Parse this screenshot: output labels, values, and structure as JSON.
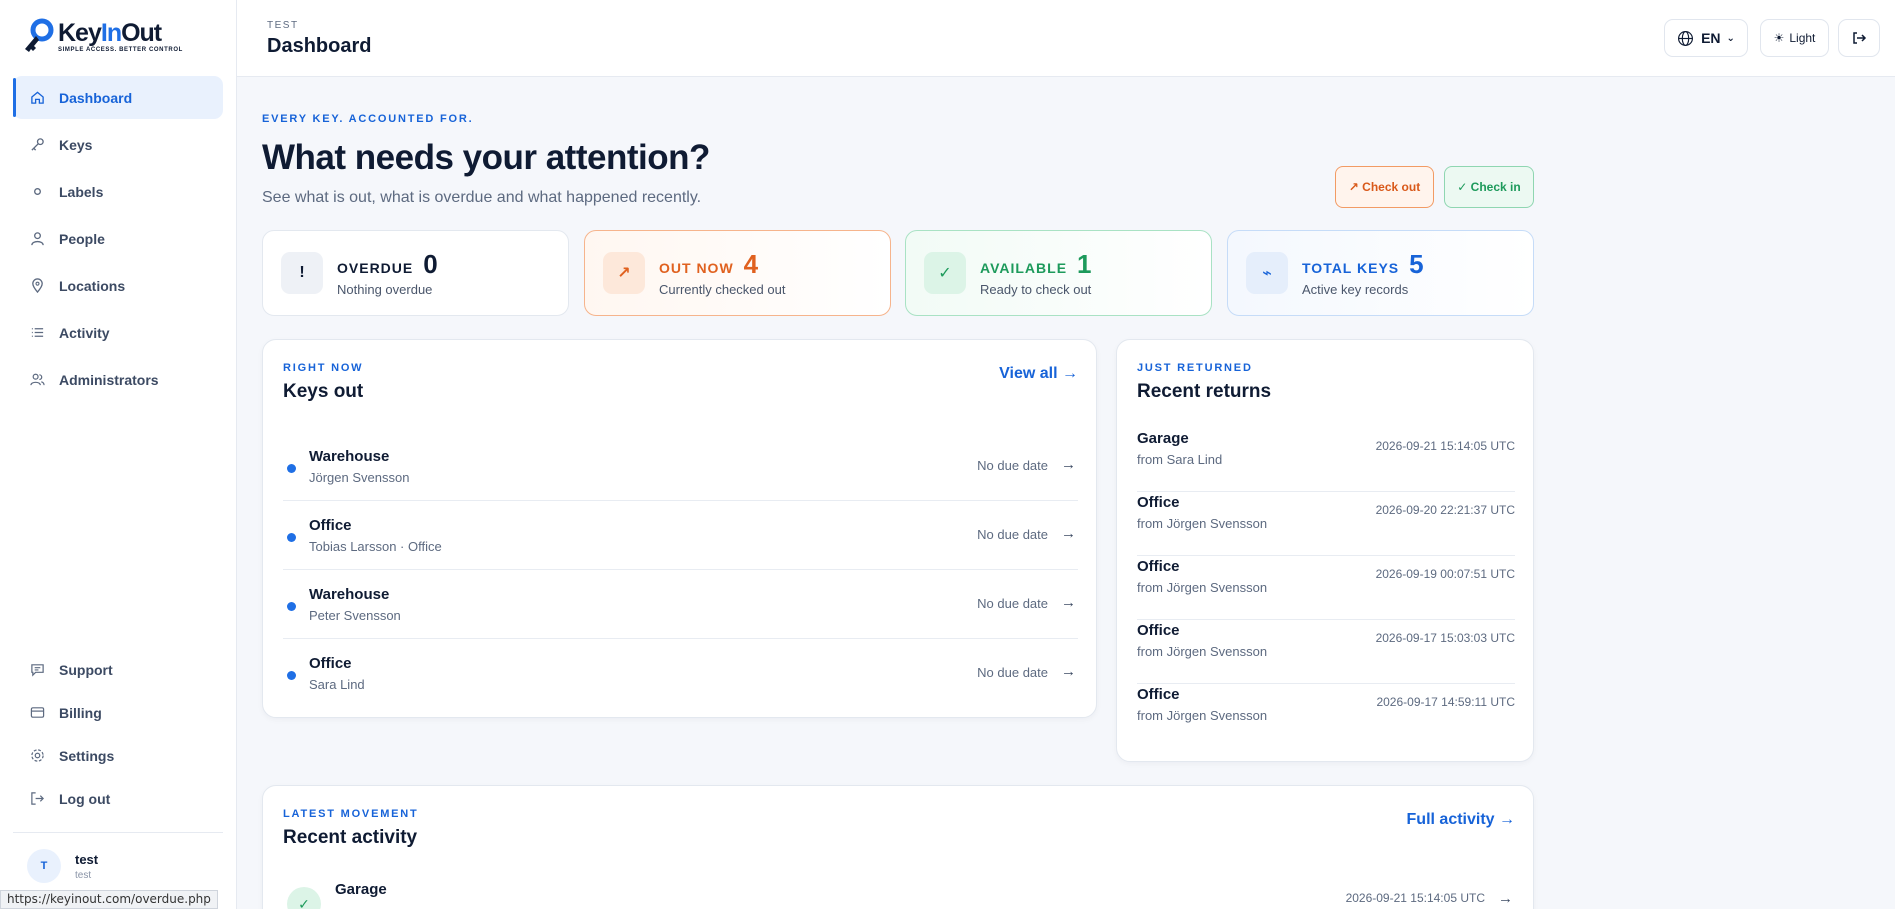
{
  "app": {
    "name_part1": "Key",
    "name_part2": "In",
    "name_part3": "Out",
    "tagline": "SIMPLE ACCESS. BETTER CONTROL",
    "accent_color": "#1f6fe5"
  },
  "sidebar": {
    "items": [
      {
        "label": "Dashboard",
        "icon": "home-icon",
        "active": true
      },
      {
        "label": "Keys",
        "icon": "key-icon"
      },
      {
        "label": "Labels",
        "icon": "circle-icon"
      },
      {
        "label": "People",
        "icon": "user-icon"
      },
      {
        "label": "Locations",
        "icon": "pin-icon"
      },
      {
        "label": "Activity",
        "icon": "list-icon"
      },
      {
        "label": "Administrators",
        "icon": "users-icon"
      }
    ],
    "bottom_items": [
      {
        "label": "Support",
        "icon": "chat-icon"
      },
      {
        "label": "Billing",
        "icon": "card-icon"
      },
      {
        "label": "Settings",
        "icon": "gear-icon"
      },
      {
        "label": "Log out",
        "icon": "logout-icon"
      }
    ],
    "user": {
      "initial": "T",
      "name": "test",
      "sub": "test"
    }
  },
  "status_url": "https://keyinout.com/overdue.php",
  "topbar": {
    "crumb": "TEST",
    "title": "Dashboard",
    "lang": "EN",
    "theme": "Light"
  },
  "hero": {
    "kicker": "EVERY KEY. ACCOUNTED FOR.",
    "title": "What needs your attention?",
    "subtitle": "See what is out, what is overdue and what happened recently.",
    "checkout_label": "↗ Check out",
    "checkin_label": "✓ Check in"
  },
  "stats": [
    {
      "label": "OVERDUE",
      "value": "0",
      "desc": "Nothing overdue",
      "glyph": "!"
    },
    {
      "label": "OUT NOW",
      "value": "4",
      "desc": "Currently checked out",
      "glyph": "↗"
    },
    {
      "label": "AVAILABLE",
      "value": "1",
      "desc": "Ready to check out",
      "glyph": "✓"
    },
    {
      "label": "TOTAL KEYS",
      "value": "5",
      "desc": "Active key records",
      "glyph": "⌁"
    }
  ],
  "keys_out": {
    "kicker": "RIGHT NOW",
    "title": "Keys out",
    "link": "View all →",
    "rows": [
      {
        "name": "Warehouse",
        "who": "Jörgen Svensson",
        "due": "No due date"
      },
      {
        "name": "Office",
        "who": "Tobias Larsson · Office",
        "due": "No due date"
      },
      {
        "name": "Warehouse",
        "who": "Peter Svensson",
        "due": "No due date"
      },
      {
        "name": "Office",
        "who": "Sara Lind",
        "due": "No due date"
      }
    ]
  },
  "returns": {
    "kicker": "JUST RETURNED",
    "title": "Recent returns",
    "rows": [
      {
        "name": "Garage",
        "from": "from Sara Lind",
        "time": "2026-09-21 15:14:05 UTC"
      },
      {
        "name": "Office",
        "from": "from Jörgen Svensson",
        "time": "2026-09-20 22:21:37 UTC"
      },
      {
        "name": "Office",
        "from": "from Jörgen Svensson",
        "time": "2026-09-19 00:07:51 UTC"
      },
      {
        "name": "Office",
        "from": "from Jörgen Svensson",
        "time": "2026-09-17 15:03:03 UTC"
      },
      {
        "name": "Office",
        "from": "from Jörgen Svensson",
        "time": "2026-09-17 14:59:11 UTC"
      }
    ]
  },
  "activity": {
    "kicker": "LATEST MOVEMENT",
    "title": "Recent activity",
    "link": "Full activity →",
    "rows": [
      {
        "name": "Garage",
        "time": "2026-09-21 15:14:05 UTC"
      }
    ]
  }
}
